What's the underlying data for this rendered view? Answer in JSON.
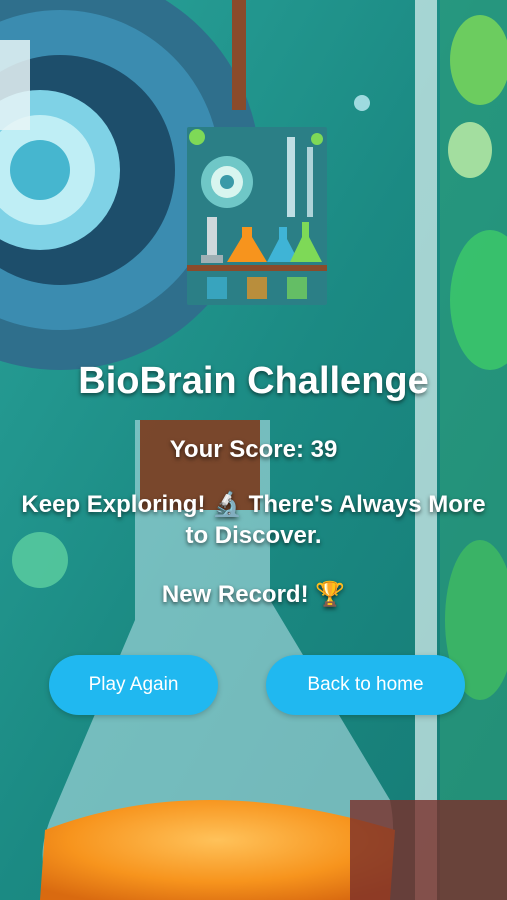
{
  "game": {
    "title": "BioBrain Challenge",
    "score_text": "Your Score: 39",
    "message": "Keep Exploring! 🔬 There's Always More to Discover.",
    "record_text": "New Record! 🏆"
  },
  "buttons": {
    "play_again": "Play Again",
    "back_home": "Back to home"
  },
  "colors": {
    "button": "#20b8f0",
    "text": "#ffffff",
    "background": "#1e8f86"
  },
  "images": {
    "background": "science-lab-flask-illustration",
    "thumbnail": "lab-equipment-thumbnail"
  }
}
